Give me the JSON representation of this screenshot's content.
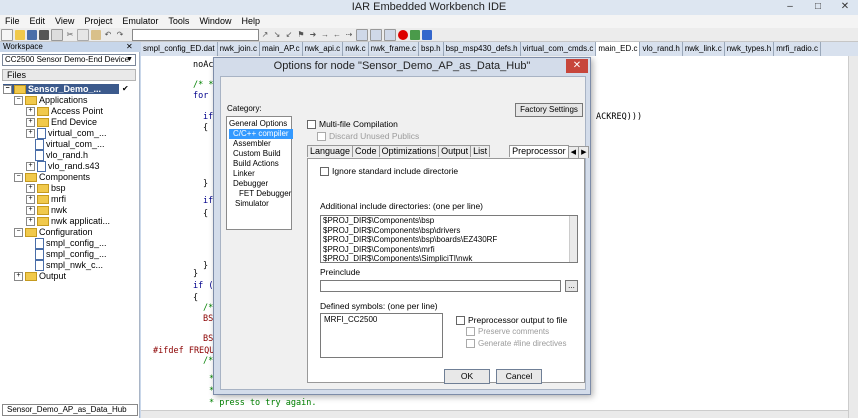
{
  "app": {
    "title": "IAR Embedded Workbench IDE",
    "window_controls": [
      "–",
      "□",
      "✕"
    ]
  },
  "menu": [
    "File",
    "Edit",
    "View",
    "Project",
    "Emulator",
    "Tools",
    "Window",
    "Help"
  ],
  "workspace": {
    "header": "Workspace",
    "config": "CC2500 Sensor Demo-End Device",
    "files_label": "Files",
    "tab": "Sensor_Demo_AP_as_Data_Hub",
    "tree": [
      {
        "label": "Sensor_Demo_...",
        "type": "root",
        "check": "✔"
      },
      {
        "label": "Applications",
        "type": "folder"
      },
      {
        "label": "Access Point",
        "type": "folder"
      },
      {
        "label": "End Device",
        "type": "folder"
      },
      {
        "label": "virtual_com_...",
        "type": "file"
      },
      {
        "label": "virtual_com_...",
        "type": "file"
      },
      {
        "label": "vlo_rand.h",
        "type": "file"
      },
      {
        "label": "vlo_rand.s43",
        "type": "file"
      },
      {
        "label": "Components",
        "type": "folder"
      },
      {
        "label": "bsp",
        "type": "folder"
      },
      {
        "label": "mrfi",
        "type": "folder"
      },
      {
        "label": "nwk",
        "type": "folder"
      },
      {
        "label": "nwk applicati...",
        "type": "folder"
      },
      {
        "label": "Configuration",
        "type": "folder"
      },
      {
        "label": "smpl_config_...",
        "type": "file"
      },
      {
        "label": "smpl_config_...",
        "type": "file"
      },
      {
        "label": "smpl_nwk_c...",
        "type": "file"
      },
      {
        "label": "Output",
        "type": "folder"
      }
    ]
  },
  "editor": {
    "tabs": [
      "smpl_config_ED.dat",
      "nwk_join.c",
      "main_AP.c",
      "nwk_api.c",
      "nwk.c",
      "nwk_frame.c",
      "bsp.h",
      "bsp_msp430_defs.h",
      "virtual_com_cmds.c",
      "main_ED.c",
      "vlo_rand.h",
      "nwk_link.c",
      "nwk_types.h",
      "mrfi_radio.c"
    ],
    "active_tab": "main_ED.c",
    "code": [
      "noAc",
      "/* *",
      "for",
      "if",
      "{",
      "ACKREQ)))",
      "}",
      "if",
      "{",
      "}",
      "}",
      "if (",
      "{",
      "/*",
      "BS",
      "BS",
      "#ifdef FREQU",
      "/*",
      "*",
      "*",
      "* press to try again."
    ]
  },
  "dialog": {
    "title": "Options for node \"Sensor_Demo_AP_as_Data_Hub\"",
    "close": "✕",
    "category_label": "Category:",
    "categories": [
      "General Options",
      "C/C++ compiler",
      "Assembler",
      "Custom Build",
      "Build Actions",
      "Linker",
      "Debugger",
      "FET Debugger",
      "Simulator"
    ],
    "selected_category": "C/C++ compiler",
    "factory_settings": "Factory Settings",
    "multifile": "Multi-file Compilation",
    "discard_unused": "Discard Unused Publics",
    "tabs": [
      "Language",
      "Code",
      "Optimizations",
      "Output",
      "List",
      "Preprocessor"
    ],
    "active_tab": "Preprocessor",
    "ignore_std": "Ignore standard include directorie",
    "include_label": "Additional include directories: (one per line)",
    "include_dirs": [
      "$PROJ_DIR$\\Components\\bsp",
      "$PROJ_DIR$\\Components\\bsp\\drivers",
      "$PROJ_DIR$\\Components\\bsp\\boards\\EZ430RF",
      "$PROJ_DIR$\\Components\\mrfi",
      "$PROJ_DIR$\\Components\\SimpliciTI\\nwk"
    ],
    "preinclude_label": "Preinclude",
    "preinclude_value": "",
    "browse": "...",
    "defined_label": "Defined symbols: (one per line)",
    "defined_symbols": "MRFI_CC2500",
    "pp_output": "Preprocessor output to file",
    "preserve_comments": "Preserve comments",
    "generate_line": "Generate #line directives",
    "ok": "OK",
    "cancel": "Cancel"
  }
}
